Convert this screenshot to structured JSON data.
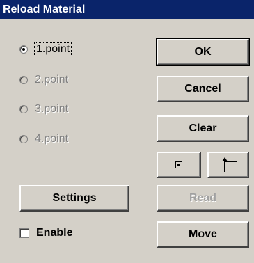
{
  "window": {
    "title": "Reload Material"
  },
  "points": [
    {
      "label": "1.point",
      "checked": true,
      "enabled": true
    },
    {
      "label": "2.point",
      "checked": false,
      "enabled": false
    },
    {
      "label": "3.point",
      "checked": false,
      "enabled": false
    },
    {
      "label": "4.point",
      "checked": false,
      "enabled": false
    }
  ],
  "buttons": {
    "ok": "OK",
    "cancel": "Cancel",
    "clear": "Clear",
    "settings": "Settings",
    "read": "Read",
    "move": "Move"
  },
  "enable_checkbox": {
    "label": "Enable",
    "checked": false
  },
  "icons": {
    "center_point": "center-point-icon",
    "corner_point": "corner-point-icon"
  },
  "colors": {
    "titlebar": "#0a246a",
    "dialog_bg": "#d4d0c8",
    "disabled_text": "#808080"
  }
}
